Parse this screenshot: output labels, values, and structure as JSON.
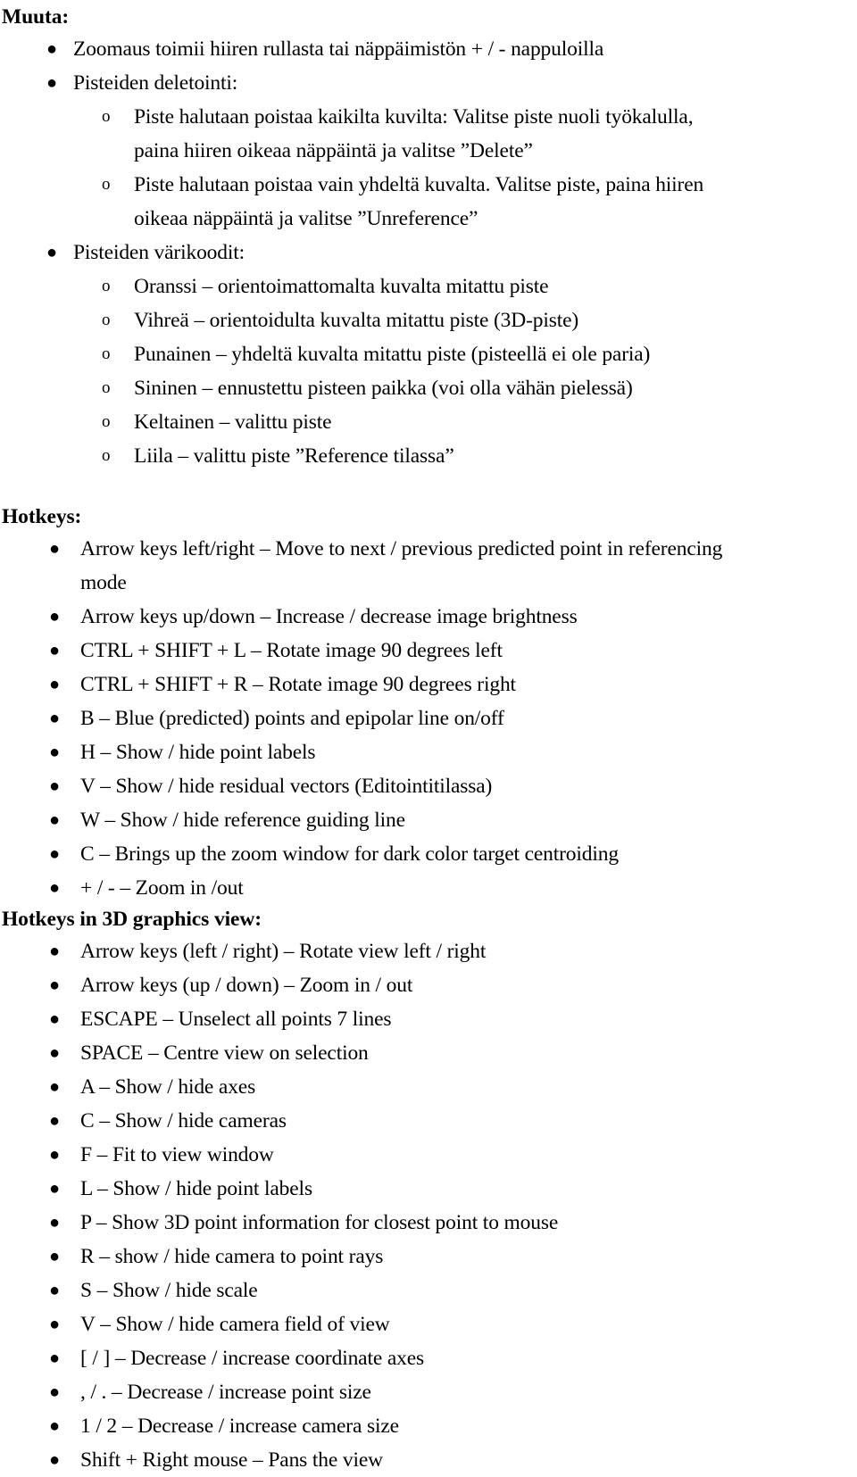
{
  "document": {
    "bullet_glyph": "●",
    "subbullet_glyph": "o",
    "sections": [
      {
        "heading": "Muuta:",
        "items": [
          {
            "type": "bullet",
            "lines": [
              "Zoomaus toimii hiiren rullasta tai näppäimistön + / - nappuloilla"
            ]
          },
          {
            "type": "bullet",
            "lines": [
              "Pisteiden deletointi:"
            ],
            "subitems": [
              {
                "lines": [
                  "Piste halutaan poistaa kaikilta kuvilta:  Valitse piste nuoli työkalulla,",
                  "paina hiiren oikeaa näppäintä ja valitse ”Delete”"
                ]
              },
              {
                "lines": [
                  "Piste halutaan poistaa vain yhdeltä kuvalta. Valitse piste, paina hiiren",
                  "oikeaa näppäintä ja valitse ”Unreference”"
                ]
              }
            ]
          },
          {
            "type": "bullet",
            "lines": [
              "Pisteiden värikoodit:"
            ],
            "subitems": [
              {
                "lines": [
                  "Oranssi – orientoimattomalta kuvalta mitattu piste"
                ]
              },
              {
                "lines": [
                  "Vihreä – orientoidulta kuvalta mitattu piste (3D-piste)"
                ]
              },
              {
                "lines": [
                  "Punainen – yhdeltä kuvalta mitattu piste (pisteellä ei ole paria)"
                ]
              },
              {
                "lines": [
                  "Sininen – ennustettu pisteen paikka (voi olla vähän pielessä)"
                ]
              },
              {
                "lines": [
                  "Keltainen – valittu piste"
                ]
              },
              {
                "lines": [
                  "Liila – valittu piste ”Reference tilassa”"
                ]
              }
            ]
          }
        ]
      },
      {
        "heading": "Hotkeys:",
        "items": [
          {
            "type": "bullet",
            "lines": [
              "Arrow keys left/right – Move to next / previous predicted point in referencing",
              "mode"
            ]
          },
          {
            "type": "bullet",
            "lines": [
              "Arrow keys up/down – Increase / decrease image brightness"
            ]
          },
          {
            "type": "bullet",
            "lines": [
              "CTRL + SHIFT + L – Rotate image 90 degrees left"
            ]
          },
          {
            "type": "bullet",
            "lines": [
              "CTRL + SHIFT + R – Rotate image 90 degrees right"
            ]
          },
          {
            "type": "bullet",
            "lines": [
              "B – Blue (predicted) points and epipolar line on/off"
            ]
          },
          {
            "type": "bullet",
            "lines": [
              "H – Show / hide point labels"
            ]
          },
          {
            "type": "bullet",
            "lines": [
              "V – Show / hide residual vectors (Editointitilassa)"
            ]
          },
          {
            "type": "bullet",
            "lines": [
              "W – Show / hide reference guiding line"
            ]
          },
          {
            "type": "bullet",
            "lines": [
              "C – Brings up the zoom window for dark color target centroiding"
            ]
          },
          {
            "type": "bullet",
            "lines": [
              "+ / - – Zoom in /out"
            ]
          }
        ]
      },
      {
        "heading": "Hotkeys in 3D graphics view:",
        "items": [
          {
            "type": "bullet",
            "lines": [
              "Arrow keys (left / right) – Rotate view left / right"
            ]
          },
          {
            "type": "bullet",
            "lines": [
              "Arrow keys (up / down) – Zoom in / out"
            ]
          },
          {
            "type": "bullet",
            "lines": [
              "ESCAPE – Unselect all points 7 lines"
            ]
          },
          {
            "type": "bullet",
            "lines": [
              "SPACE – Centre view on selection"
            ]
          },
          {
            "type": "bullet",
            "lines": [
              "A – Show / hide axes"
            ]
          },
          {
            "type": "bullet",
            "lines": [
              "C – Show / hide cameras"
            ]
          },
          {
            "type": "bullet",
            "lines": [
              "F – Fit to view window"
            ]
          },
          {
            "type": "bullet",
            "lines": [
              "L – Show / hide point labels"
            ]
          },
          {
            "type": "bullet",
            "lines": [
              "P – Show 3D point information for closest point to mouse"
            ]
          },
          {
            "type": "bullet",
            "lines": [
              "R – show / hide camera to point rays"
            ]
          },
          {
            "type": "bullet",
            "lines": [
              "S – Show / hide scale"
            ]
          },
          {
            "type": "bullet",
            "lines": [
              "V – Show / hide camera field of view"
            ]
          },
          {
            "type": "bullet",
            "lines": [
              "[ / ] – Decrease / increase coordinate axes"
            ]
          },
          {
            "type": "bullet",
            "lines": [
              ", / . – Decrease / increase point size"
            ]
          },
          {
            "type": "bullet",
            "lines": [
              "1 / 2 – Decrease / increase camera size"
            ]
          },
          {
            "type": "bullet",
            "lines": [
              "Shift + Right mouse – Pans the view"
            ]
          }
        ]
      }
    ]
  }
}
